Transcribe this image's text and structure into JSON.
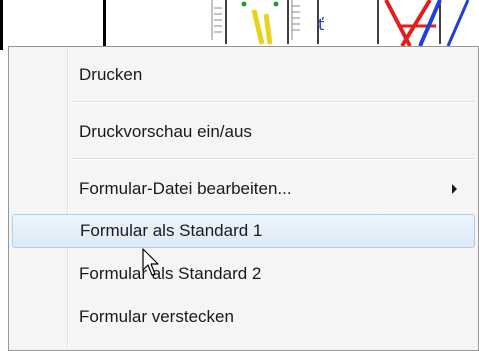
{
  "menu": {
    "items": [
      {
        "label": "Drucken"
      },
      {
        "label": "Druckvorschau ein/aus"
      },
      {
        "label": "Formular-Datei bearbeiten...",
        "submenu_icon": "chevron-right-icon"
      },
      {
        "label": "Formular als Standard 1",
        "state": "hovered"
      },
      {
        "label": "Formular als Standard 2"
      },
      {
        "label": "Formular verstecken"
      }
    ]
  },
  "colors": {
    "highlight_border": "#aecdeb",
    "menu_background": "#f5f5f5",
    "drawing_red": "#e0201c",
    "drawing_blue": "#1f3fd6",
    "drawing_yellow": "#e8d21a",
    "drawing_green": "#2a9a2a"
  },
  "icons": [
    "mouse-pointer-icon"
  ]
}
